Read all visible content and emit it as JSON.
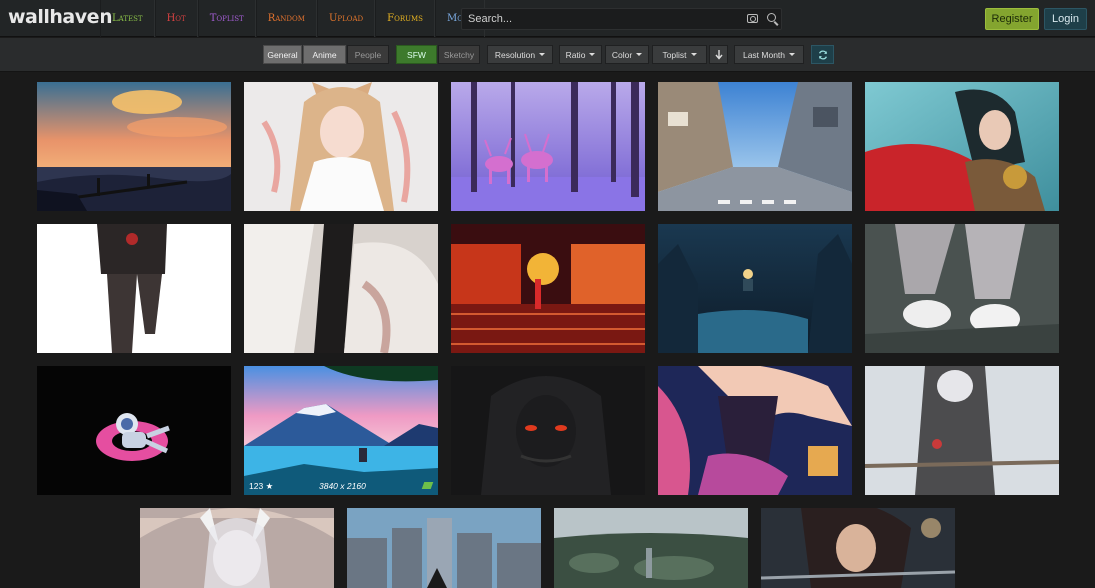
{
  "header": {
    "logo": "wallhaven",
    "nav": [
      {
        "label": "Latest",
        "color": "#8ac048"
      },
      {
        "label": "Hot",
        "color": "#d64141"
      },
      {
        "label": "Toplist",
        "color": "#a55ed6"
      },
      {
        "label": "Random",
        "color": "#e2722e"
      },
      {
        "label": "Upload",
        "color": "#e3762c"
      },
      {
        "label": "Forums",
        "color": "#e7b321"
      },
      {
        "label": "More",
        "color": "#7aa9e0"
      }
    ],
    "search_placeholder": "Search...",
    "register_label": "Register",
    "login_label": "Login"
  },
  "filters": {
    "general": "General",
    "anime": "Anime",
    "people": "People",
    "sfw": "SFW",
    "sketchy": "Sketchy",
    "resolution": "Resolution",
    "ratio": "Ratio",
    "color": "Color",
    "sorting": "Toplist",
    "range": "Last Month"
  },
  "hovered_thumb": {
    "favorites": "123",
    "resolution": "3840 x 2160"
  },
  "colors": {
    "topbar": "#222526",
    "filterbar": "#2a2c2d",
    "page_bg": "#1a1a1a",
    "register": "#84a52f",
    "login": "#1e3f49"
  }
}
